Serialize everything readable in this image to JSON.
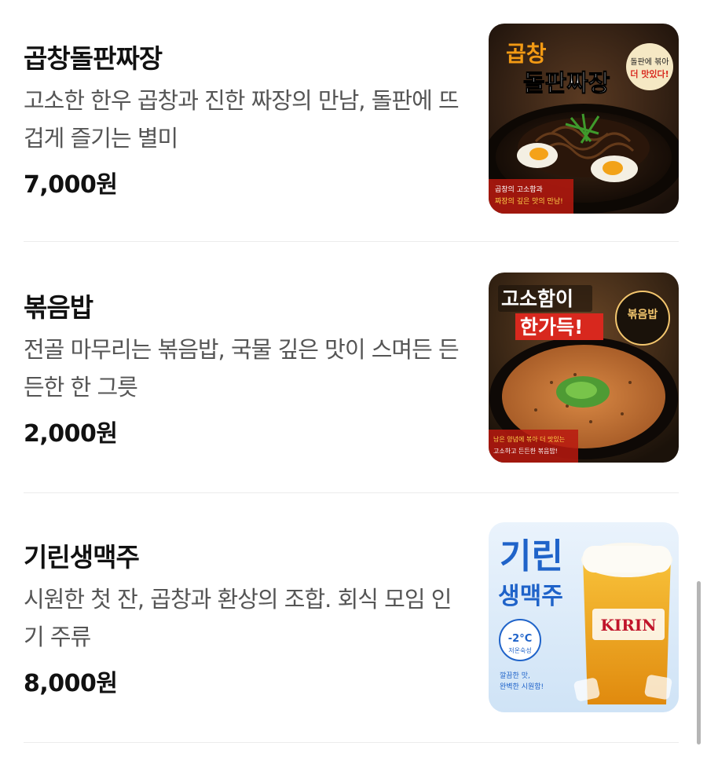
{
  "menu": [
    {
      "name": "곱창돌판짜장",
      "description": "고소한 한우 곱창과 진한 짜장의 만남, 돌판에 뜨겁게 즐기는 별미",
      "price": "7,000원",
      "image": {
        "headline_1": "곱창",
        "headline_2": "돌판짜장",
        "badge_1": "돌판에 볶아",
        "badge_2": "더 맛있다!",
        "caption_1": "곱창의 고소함과",
        "caption_2": "짜장의 깊은 맛의 만남!"
      }
    },
    {
      "name": "볶음밥",
      "description": "전골 마무리는 볶음밥, 국물 깊은 맛이 스며든 든든한 한 그릇",
      "price": "2,000원",
      "image": {
        "headline_1": "고소함이",
        "headline_2": "한가득!",
        "badge_1": "볶음밥",
        "caption_1": "남은 양념에 볶아 더 맛있는",
        "caption_2": "고소하고 든든한 볶음밥!"
      }
    },
    {
      "name": "기린생맥주",
      "description": "시원한 첫 잔, 곱창과 환상의 조합. 회식 모임 인기 주류",
      "price": "8,000원",
      "image": {
        "headline_1": "기린",
        "headline_2": "생맥주",
        "temp": "-2°C",
        "temp_label": "저온숙성",
        "brand": "KIRIN",
        "caption_1": "깔끔한 맛,",
        "caption_2": "완벽한 시원함!"
      }
    }
  ],
  "colors": {
    "accent_red": "#d8281e",
    "accent_orange": "#f39a14",
    "beer_blue": "#1f63c9",
    "text_primary": "#111111",
    "text_secondary": "#555555",
    "divider": "#ececec"
  }
}
